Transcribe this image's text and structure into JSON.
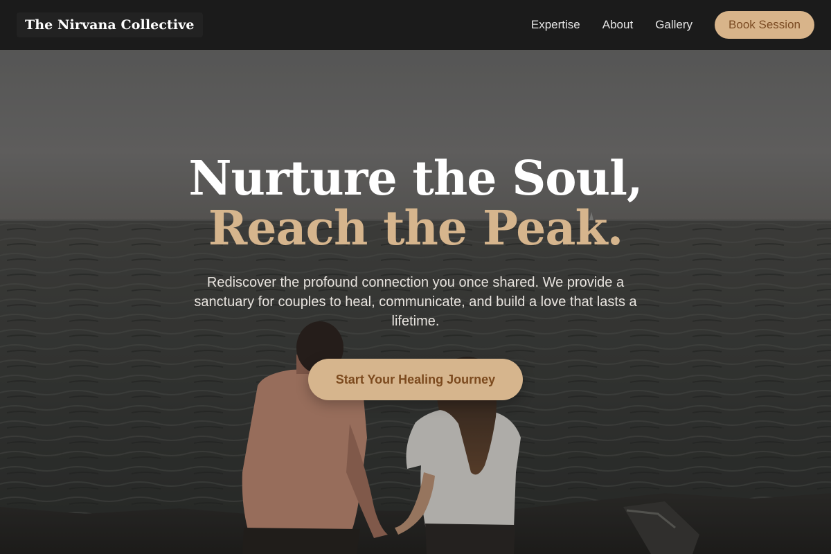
{
  "brand": {
    "name": "The Nirvana Collective"
  },
  "nav": {
    "links": [
      "Expertise",
      "About",
      "Gallery"
    ],
    "cta_label": "Book Session"
  },
  "hero": {
    "headline_main": "Nurture the Soul, ",
    "headline_accent": "Reach the Peak.",
    "subtitle": "Rediscover the profound connection you once shared. We provide a sanctuary for couples to heal, communicate, and build a love that lasts a lifetime.",
    "cta_label": "Start Your Healing Journey"
  },
  "colors": {
    "navbar_bg": "#1b1b1b",
    "accent": "#d6b58d",
    "accent_text": "#7c4a1e",
    "headline": "#ffffff"
  }
}
